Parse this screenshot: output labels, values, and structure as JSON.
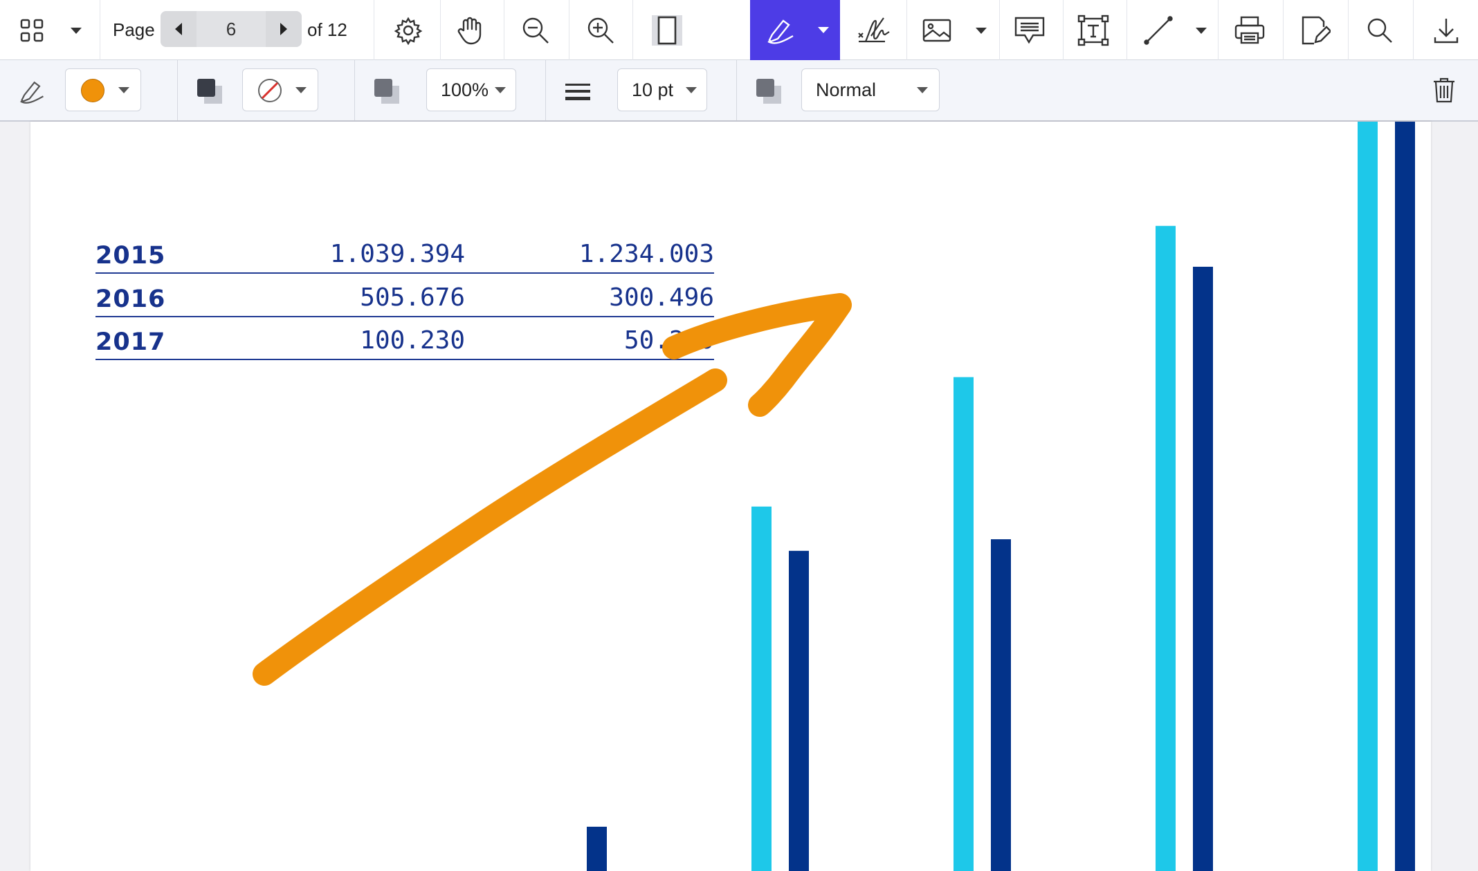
{
  "toolbar": {
    "page_label": "Page",
    "page_current": "6",
    "page_total": "of 12",
    "icons": [
      "thumbnails-icon",
      "settings-icon",
      "pan-hand-icon",
      "zoom-out-icon",
      "zoom-in-icon",
      "single-page-icon",
      "freehand-pen-icon",
      "signature-icon",
      "image-icon",
      "comment-icon",
      "text-box-icon",
      "line-icon",
      "print-icon",
      "edit-icon",
      "search-icon",
      "download-icon"
    ],
    "accent": "#4d3ce6"
  },
  "annotation_bar": {
    "stroke_color": "#f0920a",
    "opacity": "100%",
    "line_width": "10 pt",
    "blend_mode": "Normal"
  },
  "table": {
    "rows": [
      {
        "year": "2015",
        "v1": "1.039.394",
        "v2": "1.234.003"
      },
      {
        "year": "2016",
        "v1": "505.676",
        "v2": "300.496"
      },
      {
        "year": "2017",
        "v1": "100.230",
        "v2": "50.230"
      }
    ],
    "color": "#17328c"
  },
  "chart_data": {
    "type": "bar",
    "categories": [
      "",
      "",
      "",
      "",
      ""
    ],
    "series": [
      {
        "color": "#1ec8e9",
        "values": [
          0,
          535,
          725,
          947,
          1100
        ]
      },
      {
        "color": "#03338a",
        "values": [
          65,
          470,
          487,
          887,
          1100
        ]
      }
    ],
    "ylim": [
      0,
      1100
    ],
    "grid": false,
    "colors": {
      "light": "#1ec8e9",
      "dark": "#03338a"
    }
  },
  "annotation": {
    "type": "freehand-arrow",
    "color": "#f0920a"
  }
}
